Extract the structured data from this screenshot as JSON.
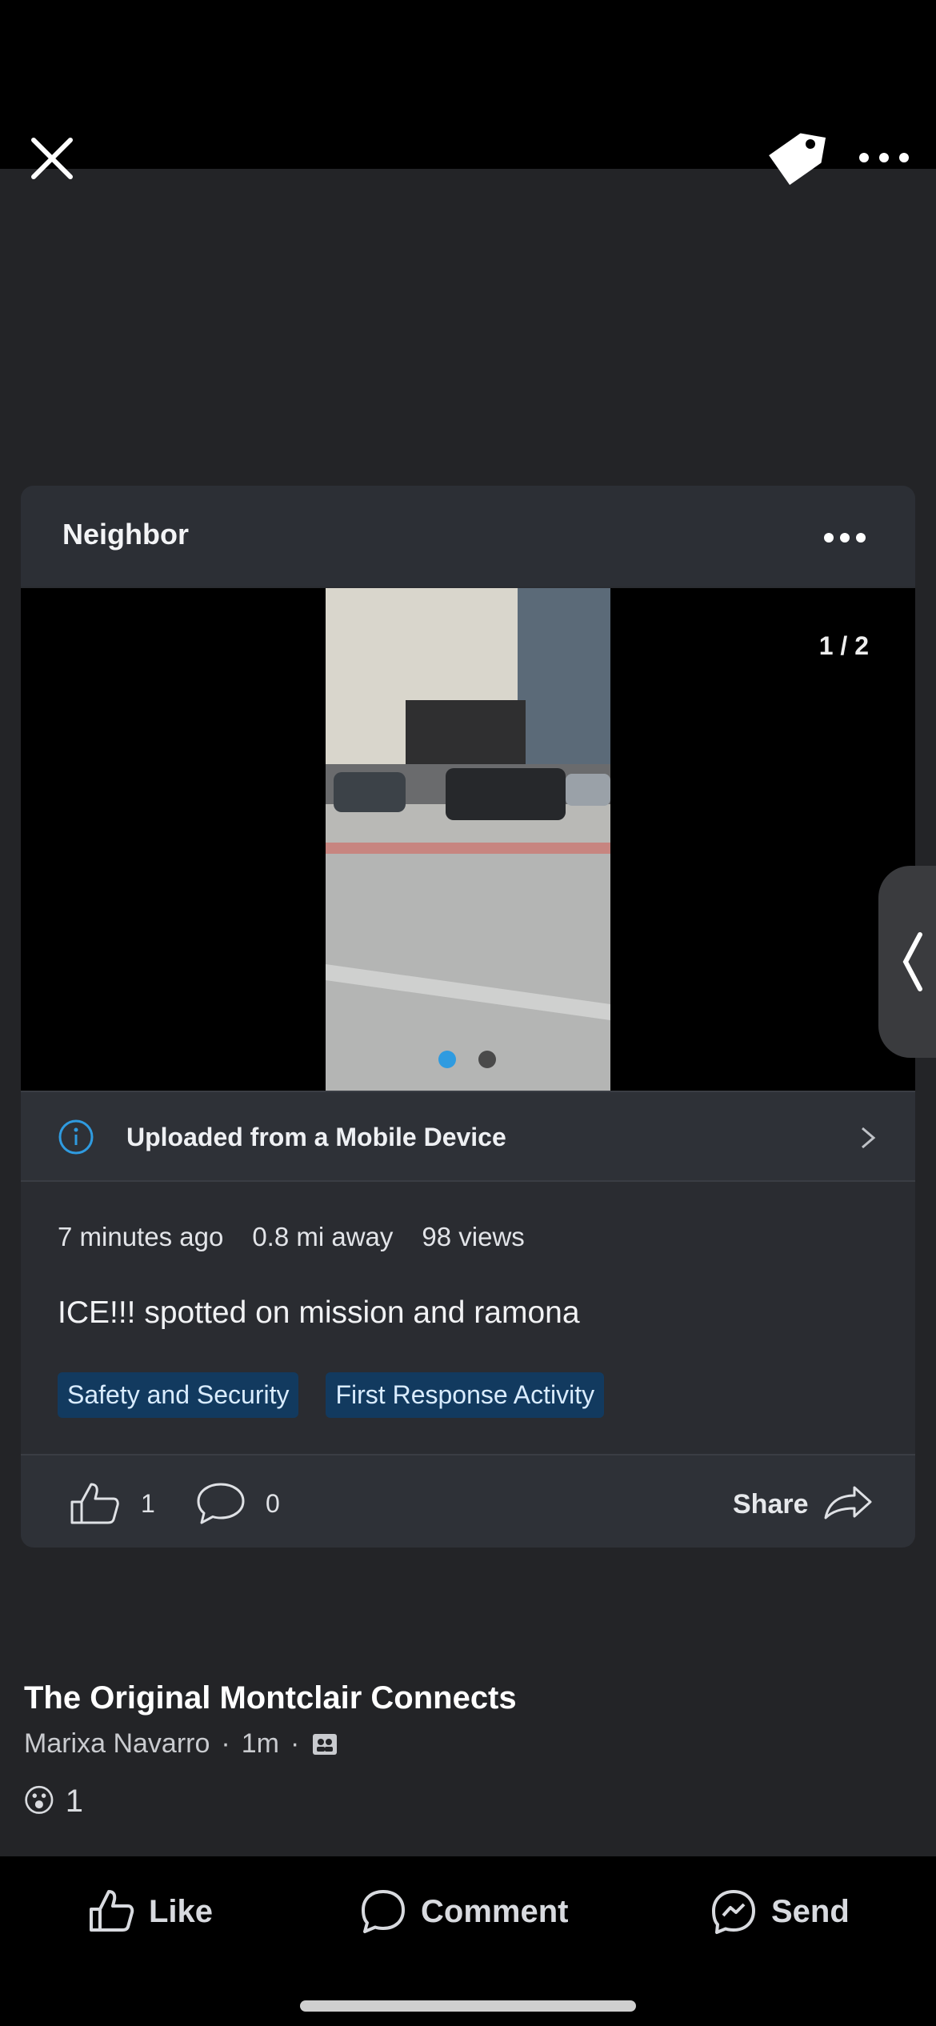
{
  "topbar": {
    "close_icon": "close-icon",
    "tag_icon": "tag-icon",
    "more_icon": "more-horizontal-icon"
  },
  "post_card": {
    "header_title": "Neighbor",
    "media_counter": "1 / 2",
    "media_dots": 2,
    "active_dot": 1,
    "upload_text": "Uploaded from a Mobile Device",
    "meta": {
      "time": "7 minutes ago",
      "distance": "0.8 mi away",
      "views": "98 views"
    },
    "body": "ICE!!!  spotted on mission and ramona",
    "tags": [
      "Safety and Security",
      "First Response Activity"
    ],
    "actions": {
      "like_count": "1",
      "comment_count": "0",
      "share_label": "Share"
    }
  },
  "shared_post": {
    "group_name": "The Original Montclair Connects",
    "author": "Marixa Navarro",
    "separator": "·",
    "time": "1m",
    "reaction_emoji": "😮",
    "reaction_count": "1"
  },
  "bottom_actions": {
    "like": "Like",
    "comment": "Comment",
    "send": "Send"
  },
  "colors": {
    "background": "#232427",
    "card": "#2a2c31",
    "accent_blue": "#2f9be0",
    "tag_bg": "#123a5f"
  }
}
